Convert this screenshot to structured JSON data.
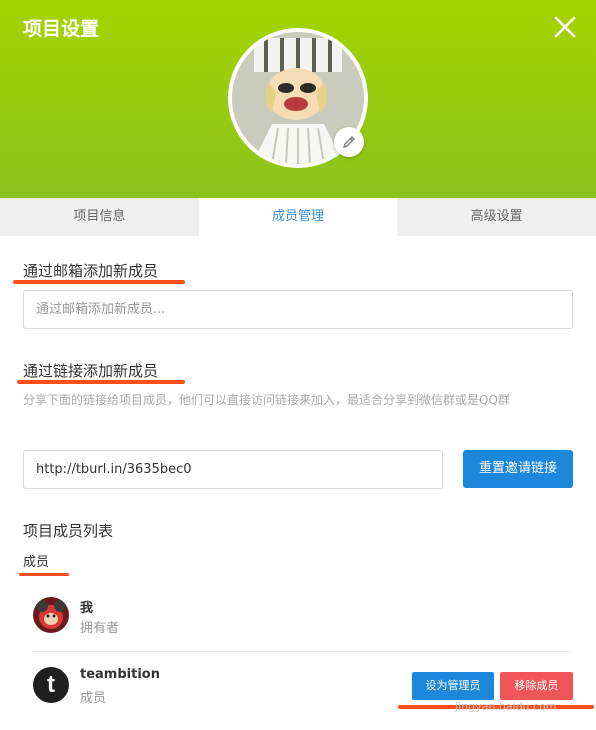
{
  "header": {
    "title": "项目设置",
    "bg_color": "#9acd14"
  },
  "icons": {
    "close": "close-icon",
    "edit": "pencil-icon"
  },
  "tabs": [
    {
      "label": "项目信息",
      "active": false
    },
    {
      "label": "成员管理",
      "active": true
    },
    {
      "label": "高级设置",
      "active": false
    }
  ],
  "email_section": {
    "title": "通过邮箱添加新成员",
    "placeholder": "通过邮箱添加新成员..."
  },
  "link_section": {
    "title": "通过链接添加新成员",
    "description": "分享下面的链接给项目成员，他们可以直接访问链接来加入，最适合分享到微信群或是QQ群",
    "link_value": "http://tburl.in/3635bec0",
    "reset_button": "重置邀请链接"
  },
  "member_list": {
    "title": "项目成员列表",
    "group_label": "成员",
    "members": [
      {
        "name": "我",
        "role": "拥有者"
      },
      {
        "name": "teambition",
        "role": "成员",
        "avatar_letter": "t"
      }
    ],
    "set_admin_button": "设为管理员",
    "remove_button": "移除成员"
  },
  "watermark": "jingyan.baidu.com",
  "colors": {
    "accent_blue": "#1d87db",
    "danger_red": "#f0555a",
    "annotation_orange": "#ff4e1a"
  }
}
